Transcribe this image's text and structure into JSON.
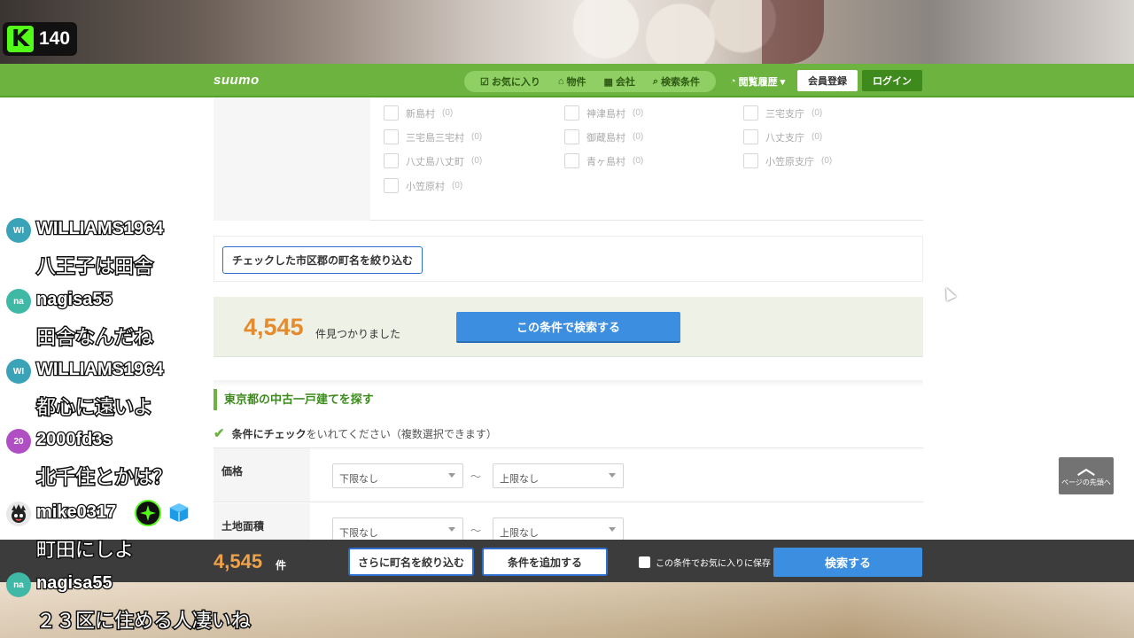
{
  "stream": {
    "viewer_count": "140",
    "platform_logo": "K"
  },
  "header": {
    "logo": "suumo",
    "nav": [
      {
        "icon": "favorite-icon",
        "label": "お気に入り"
      },
      {
        "icon": "home-icon",
        "label": "物件"
      },
      {
        "icon": "building-icon",
        "label": "会社"
      },
      {
        "icon": "search-icon",
        "label": "検索条件"
      }
    ],
    "history_label": "閲覧履歴",
    "register_label": "会員登録",
    "login_label": "ログイン"
  },
  "checklist": [
    {
      "name": "新島村",
      "count": "(0)"
    },
    {
      "name": "神津島村",
      "count": "(0)"
    },
    {
      "name": "三宅支庁",
      "count": "(0)"
    },
    {
      "name": "三宅島三宅村",
      "count": "(0)"
    },
    {
      "name": "御蔵島村",
      "count": "(0)"
    },
    {
      "name": "八丈支庁",
      "count": "(0)"
    },
    {
      "name": "八丈島八丈町",
      "count": "(0)"
    },
    {
      "name": "青ヶ島村",
      "count": "(0)"
    },
    {
      "name": "小笠原支庁",
      "count": "(0)"
    },
    {
      "name": "小笠原村",
      "count": "(0)"
    }
  ],
  "narrow_button": "チェックした市区郡の町名を絞り込む",
  "result": {
    "count": "4,545",
    "suffix": "件見つかりました",
    "search_button": "この条件で検索する"
  },
  "section_title": "東京都の中古一戸建てを探す",
  "instruction": {
    "bold": "条件にチェック",
    "rest": "をいれてください（複数選択できます）"
  },
  "form": {
    "rows": [
      {
        "label": "価格",
        "min": "下限なし",
        "max": "上限なし"
      },
      {
        "label": "土地面積",
        "min": "下限なし",
        "max": "上限なし"
      }
    ],
    "tilde": "〜"
  },
  "page_top": {
    "label": "ページの先頭へ"
  },
  "bottom_bar": {
    "count": "4,545",
    "unit": "件",
    "narrow_button": "さらに町名を絞り込む",
    "add_button": "条件を追加する",
    "save_label": "この条件でお気に入りに保存",
    "search_button": "検索する"
  },
  "chat": [
    {
      "initials": "WI",
      "avatar_color": "#3aa3b8",
      "user": "WILLIAMS1964",
      "text": "八王子は田舎"
    },
    {
      "initials": "na",
      "avatar_color": "#3fb9a6",
      "user": "nagisa55",
      "text": "田舎なんだね"
    },
    {
      "initials": "WI",
      "avatar_color": "#3aa3b8",
      "user": "WILLIAMS1964",
      "text": "都心に遠いよ"
    },
    {
      "initials": "20",
      "avatar_color": "#b04fc4",
      "user": "2000fd3s",
      "text": "北千住とかは？"
    },
    {
      "initials": "",
      "avatar_color": "#e8e8e8",
      "user": "mike0317",
      "text": "町田にしよ",
      "badges": [
        "sparkle-badge-icon",
        "cube-badge-icon"
      ]
    },
    {
      "initials": "na",
      "avatar_color": "#3fb9a6",
      "user": "nagisa55",
      "text": "２３区に住める人凄いね"
    }
  ],
  "colors": {
    "brand_green": "#6db33f",
    "accent_orange": "#e68a2e",
    "search_blue": "#3b8ee0",
    "kick_green": "#53fc18"
  }
}
